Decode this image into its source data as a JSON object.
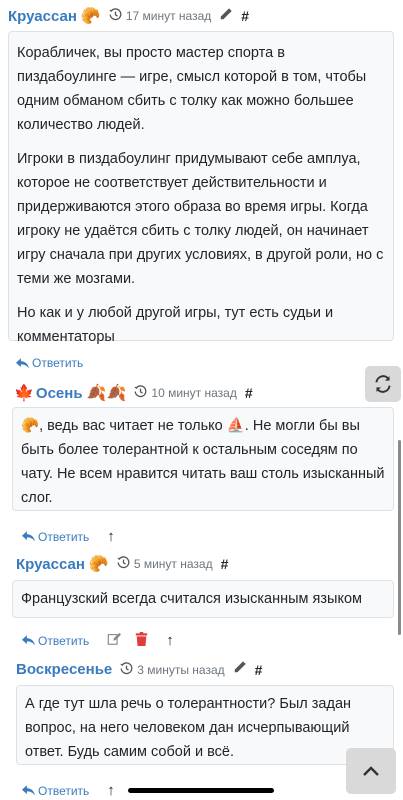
{
  "comments": [
    {
      "author": "Круассан",
      "emoji": "🥐",
      "time": "17 минут назад",
      "hash": "#",
      "paragraphs": [
        "Корабличек, вы просто мастер спорта в пиздабоулинге — игре, смысл которой в том, чтобы одним обманом сбить с толку как можно большее количество людей.",
        "Игроки в пиздабоулинг придумывают себе амплуа, которое не соответствует действительности и придерживаются этого образа во время игры. Когда игроку не удаётся сбить с толку людей, он начинает игру сначала при других условиях, в другой роли, но с теми же мозгами.",
        "Но как и у любой другой игры, тут есть судьи и комментаторы"
      ],
      "reply": "Ответить"
    },
    {
      "author": "Осень",
      "emoji_before": "🍁",
      "emoji_after": "🍂🍂",
      "time": "10 минут назад",
      "hash": "#",
      "text_prefix": "🥐",
      "text_mid": ", ведь вас читает не только ",
      "text_emoji": "⛵",
      "text_rest": ". Не могли бы вы быть более толерантной к остальным соседям по чату. Не всем нравится читать ваш столь изысканный слог.",
      "reply": "Ответить",
      "up": "↑"
    },
    {
      "author": "Круассан",
      "emoji": "🥐",
      "time": "5 минут назад",
      "hash": "#",
      "text": "Французский всегда считался изысканным языком",
      "reply": "Ответить",
      "up": "↑"
    },
    {
      "author": "Воскресенье",
      "time": "3 минуты назад",
      "hash": "#",
      "text": "А где тут шла речь о толерантности? Был задан вопрос, на него человеком дан исчерпывающий ответ. Будь самим собой и всё.",
      "reply": "Ответить",
      "up": "↑"
    }
  ],
  "colors": {
    "link": "#3a7bbf",
    "delete": "#e03c3c",
    "bubble_bg": "#f8f9fa"
  },
  "icons": [
    "clock-icon",
    "pencil-icon",
    "reply-icon",
    "edit-icon",
    "trash-icon",
    "refresh-icon",
    "chevron-up-icon"
  ]
}
